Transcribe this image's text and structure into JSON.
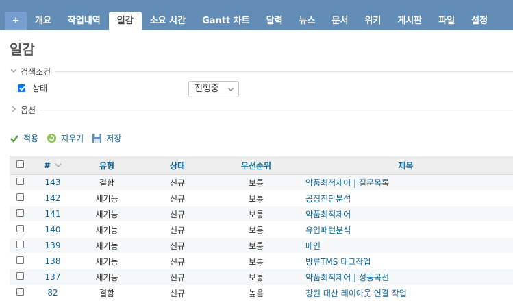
{
  "nav": {
    "add_label": "+",
    "tabs": [
      {
        "label": "개요"
      },
      {
        "label": "작업내역"
      },
      {
        "label": "일감",
        "selected": true
      },
      {
        "label": "소요 시간"
      },
      {
        "label": "Gantt 차트"
      },
      {
        "label": "달력"
      },
      {
        "label": "뉴스"
      },
      {
        "label": "문서"
      },
      {
        "label": "위키"
      },
      {
        "label": "게시판"
      },
      {
        "label": "파일"
      },
      {
        "label": "설정"
      }
    ]
  },
  "page": {
    "title": "일감"
  },
  "filters": {
    "legend": "검색조건",
    "status_label": "상태",
    "status_checked": true,
    "status_value": "진행중"
  },
  "options": {
    "legend": "옵션"
  },
  "actions": {
    "apply": "적용",
    "clear": "지우기",
    "save": "저장"
  },
  "table": {
    "headers": {
      "id": "#",
      "type": "유형",
      "status": "상태",
      "priority": "우선순위",
      "subject": "제목"
    },
    "rows": [
      {
        "id": "143",
        "type": "결함",
        "status": "신규",
        "priority": "보통",
        "subject": "약품최적제어 | 질문목록"
      },
      {
        "id": "142",
        "type": "새기능",
        "status": "신규",
        "priority": "보통",
        "subject": "공정진단분석"
      },
      {
        "id": "141",
        "type": "새기능",
        "status": "신규",
        "priority": "보통",
        "subject": "약품최적제어"
      },
      {
        "id": "140",
        "type": "새기능",
        "status": "신규",
        "priority": "보통",
        "subject": "유입패턴분석"
      },
      {
        "id": "139",
        "type": "새기능",
        "status": "신규",
        "priority": "보통",
        "subject": "메인"
      },
      {
        "id": "138",
        "type": "새기능",
        "status": "신규",
        "priority": "보통",
        "subject": "방류TMS 태그작업"
      },
      {
        "id": "137",
        "type": "새기능",
        "status": "신규",
        "priority": "보통",
        "subject": "약품최적제어 | 성능곡선"
      },
      {
        "id": "82",
        "type": "결함",
        "status": "신규",
        "priority": "높음",
        "subject": "창원 대산 레이아웃 연결 작업"
      }
    ]
  },
  "colors": {
    "header_bar": "#628db6",
    "link": "#116699"
  }
}
